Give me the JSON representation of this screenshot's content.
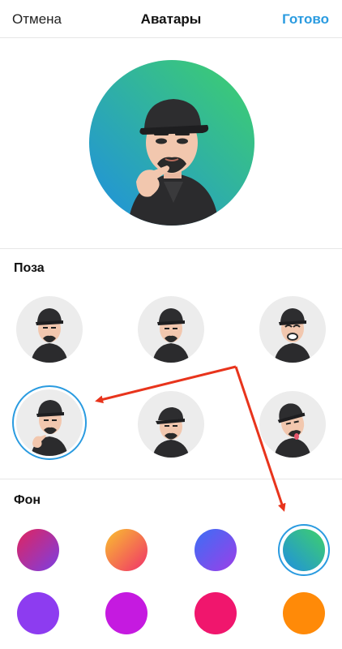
{
  "header": {
    "cancel_label": "Отмена",
    "title": "Аватары",
    "done_label": "Готово"
  },
  "sections": {
    "pose_title": "Поза",
    "background_title": "Фон"
  },
  "poses": {
    "selected_index": 3,
    "items": [
      "pose-1",
      "pose-2",
      "pose-3",
      "pose-4",
      "pose-5",
      "pose-6"
    ]
  },
  "backgrounds": {
    "selected_index": 3,
    "items": [
      {
        "name": "purple-red-gradient",
        "colors": [
          "#7b3fe4",
          "#e0245e"
        ]
      },
      {
        "name": "orange-pink-gradient",
        "colors": [
          "#f9c02f",
          "#f0316a"
        ]
      },
      {
        "name": "blue-purple-gradient",
        "colors": [
          "#3b6ff5",
          "#9c3ee8"
        ]
      },
      {
        "name": "green-blue-gradient",
        "colors": [
          "#3fd16a",
          "#1f8fe0"
        ]
      },
      {
        "name": "violet",
        "colors": [
          "#8d3cf0",
          "#8d3cf0"
        ]
      },
      {
        "name": "magenta",
        "colors": [
          "#c51ae0",
          "#c51ae0"
        ]
      },
      {
        "name": "pink-red",
        "colors": [
          "#f0166d",
          "#f0166d"
        ]
      },
      {
        "name": "orange",
        "colors": [
          "#ff8a08",
          "#ff8a08"
        ]
      }
    ]
  },
  "colors": {
    "accent": "#2a9be0",
    "annotation_arrow": "#e8341c"
  }
}
